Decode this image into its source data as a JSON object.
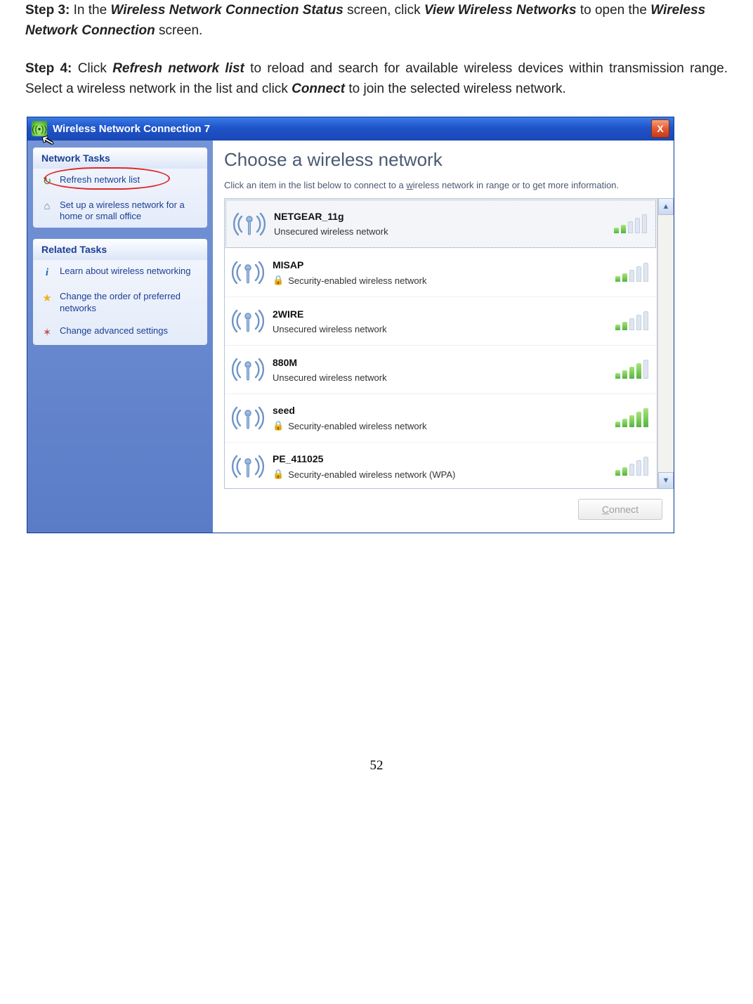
{
  "doc": {
    "step3": {
      "label": "Step 3:",
      "t1": " In the ",
      "b1": "Wireless Network Connection Status",
      "t2": " screen, click ",
      "b2": "View Wireless Networks",
      "t3": " to open the ",
      "b3": "Wireless Network Connection",
      "t4": " screen."
    },
    "step4": {
      "label": "Step 4:",
      "t1": " Click ",
      "b1": "Refresh network list",
      "t2": " to reload and search for available wireless devices within transmission range. Select a wireless network in the list and click ",
      "b2": "Connect",
      "t3": " to join the selected wireless network."
    },
    "page": "52"
  },
  "window": {
    "title": "Wireless Network Connection 7",
    "close": "X",
    "sidebar": {
      "group1": {
        "title": "Network Tasks",
        "items": [
          {
            "icon": "refresh-icon",
            "label": "Refresh network list"
          },
          {
            "icon": "setup-icon",
            "label": "Set up a wireless network for a home or small office"
          }
        ]
      },
      "group2": {
        "title": "Related Tasks",
        "items": [
          {
            "icon": "info-icon",
            "label": "Learn about wireless networking"
          },
          {
            "icon": "star-icon",
            "label": "Change the order of preferred networks"
          },
          {
            "icon": "gear-icon",
            "label": "Change advanced settings"
          }
        ]
      }
    },
    "main": {
      "heading": "Choose a wireless network",
      "sub_pre": "Click an item in the list below to connect to a ",
      "sub_u": "w",
      "sub_post": "ireless network in range or to get more information.",
      "networks": [
        {
          "name": "NETGEAR_11g",
          "security": "Unsecured wireless network",
          "secure": false,
          "bars": 2,
          "selected": true
        },
        {
          "name": "MISAP",
          "security": "Security-enabled wireless network",
          "secure": true,
          "bars": 2
        },
        {
          "name": "2WIRE",
          "security": "Unsecured wireless network",
          "secure": false,
          "bars": 2
        },
        {
          "name": "880M",
          "security": "Unsecured wireless network",
          "secure": false,
          "bars": 4
        },
        {
          "name": "seed",
          "security": "Security-enabled wireless network",
          "secure": true,
          "bars": 5
        },
        {
          "name": "PE_411025",
          "security": "Security-enabled wireless network (WPA)",
          "secure": true,
          "bars": 2
        }
      ],
      "connect": "Connect",
      "connect_accel": "C"
    }
  }
}
